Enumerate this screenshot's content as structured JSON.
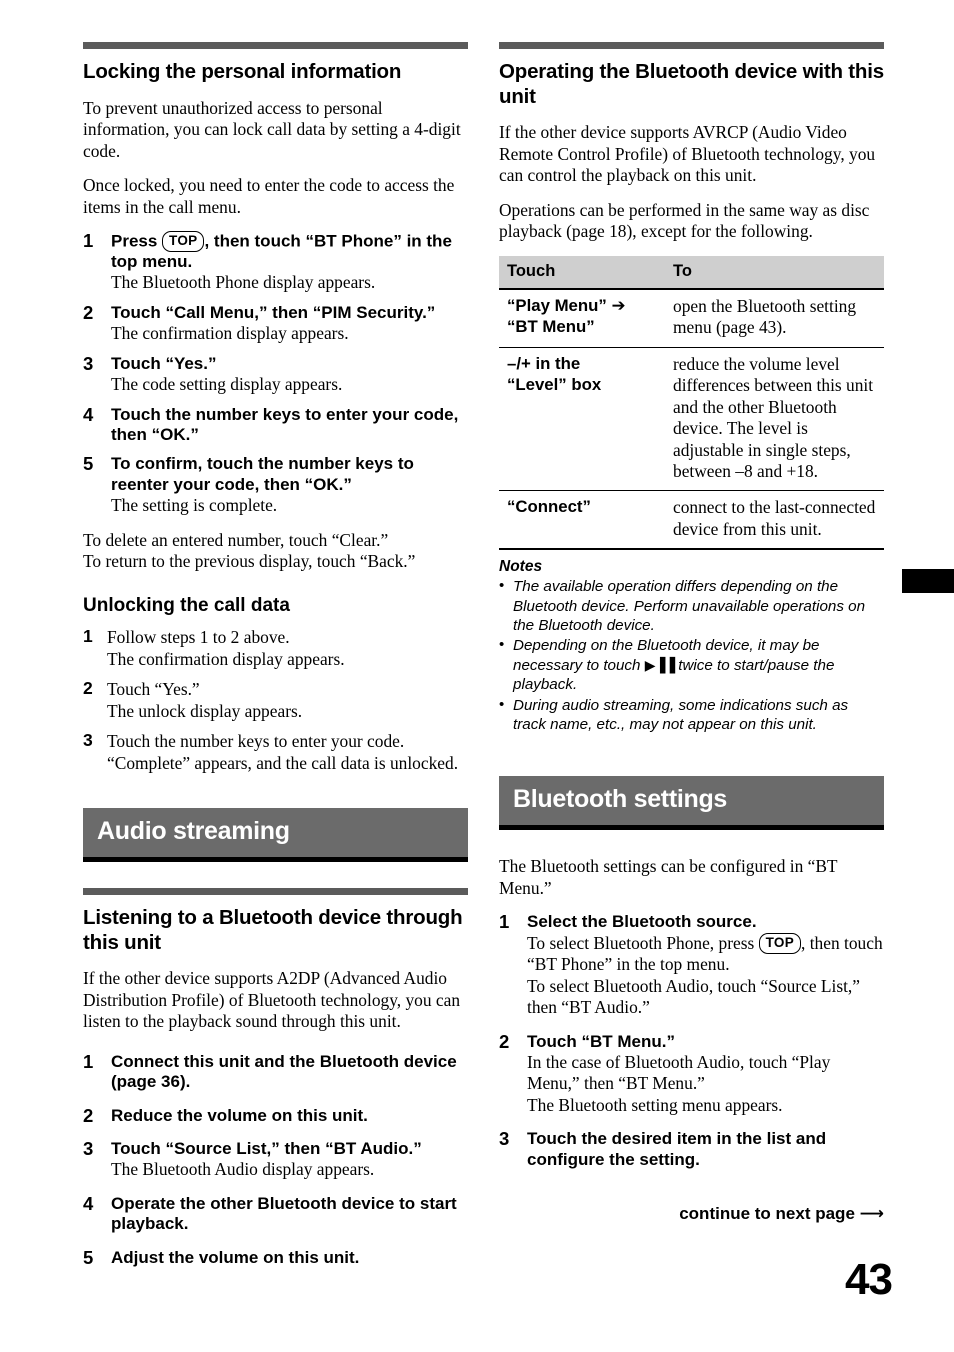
{
  "page": {
    "folio": "43",
    "edge_tab_color": "#000000",
    "banner_color": "#6b6b6b",
    "rule_color": "#5b5b5b",
    "table_header_color": "#cfcfcf"
  },
  "left_column": {
    "heading": "Locking the personal information",
    "intro_1": "To prevent unauthorized access to personal information, you can lock call data by setting a 4-digit code.",
    "intro_2": "Once locked, you need to enter the code to access the items in the call menu.",
    "steps": [
      {
        "num": "1",
        "lead_before_key": "Press ",
        "key": "TOP",
        "lead_after_key": ", then touch “BT Phone” in the top menu.",
        "note": "The Bluetooth Phone display appears."
      },
      {
        "num": "2",
        "lead": "Touch “Call Menu,” then “PIM Security.”",
        "note": "The confirmation display appears."
      },
      {
        "num": "3",
        "lead": "Touch “Yes.”",
        "note": "The code setting display appears."
      },
      {
        "num": "4",
        "lead": "Touch the number keys to enter your code, then “OK.”",
        "note": ""
      },
      {
        "num": "5",
        "lead": "To confirm, touch the number keys to reenter your code, then “OK.”",
        "note": "The setting is complete."
      }
    ],
    "outro_1": "To delete an entered number, touch “Clear.”",
    "outro_2": "To return to the previous display, touch “Back.”",
    "unlock_heading": "Unlocking the call data",
    "unlock_steps": [
      {
        "num": "1",
        "lead": "Follow steps 1 to 2 above.",
        "note": "The confirmation display appears."
      },
      {
        "num": "2",
        "lead": "Touch “Yes.”",
        "note": "The unlock display appears."
      },
      {
        "num": "3",
        "lead": "Touch the number keys to enter your code.",
        "note": "“Complete” appears, and the call data is unlocked."
      }
    ],
    "banner": "Audio streaming",
    "listening_heading": "Listening to a Bluetooth device through this unit",
    "listening_intro": "If the other device supports A2DP (Advanced Audio Distribution Profile) of Bluetooth technology, you can listen to the playback sound through this unit.",
    "listening_steps": [
      {
        "num": "1",
        "lead": "Connect this unit and the Bluetooth device (page 36).",
        "note": ""
      },
      {
        "num": "2",
        "lead": "Reduce the volume on this unit.",
        "note": ""
      },
      {
        "num": "3",
        "lead": "Touch “Source List,” then “BT Audio.”",
        "note": "The Bluetooth Audio display appears."
      },
      {
        "num": "4",
        "lead": "Operate the other Bluetooth device to start playback.",
        "note": ""
      },
      {
        "num": "5",
        "lead": "Adjust the volume on this unit.",
        "note": ""
      }
    ]
  },
  "right_column": {
    "heading": "Operating the Bluetooth device with this unit",
    "intro_1": "If the other device supports AVRCP (Audio Video Remote Control Profile) of Bluetooth technology, you can control the playback on this unit.",
    "intro_2": "Operations can be performed in the same way as disc playback (page 18), except for the following.",
    "table": {
      "headers": [
        "Touch",
        "To"
      ],
      "rows": [
        {
          "touch_line1": "“Play Menu” ➔",
          "touch_line2": "“BT Menu”",
          "to": "open the Bluetooth setting menu (page 43)."
        },
        {
          "touch_line1": "–/+ in the",
          "touch_line2": "“Level” box",
          "to": "reduce the volume level differences between this unit and the other Bluetooth device. The level is adjustable in single steps, between –8 and +18."
        },
        {
          "touch_line1": "“Connect”",
          "touch_line2": "",
          "to": "connect to the last-connected device from this unit."
        }
      ]
    },
    "notes_title": "Notes",
    "notes": [
      {
        "text_before": "The available operation differs depending on the Bluetooth device. Perform unavailable operations on the Bluetooth device.",
        "glyph": "",
        "text_after": ""
      },
      {
        "text_before": "Depending on the Bluetooth device, it may be necessary to touch ",
        "glyph": "▶▐▐",
        "text_after": " twice to start/pause the playback."
      },
      {
        "text_before": "During audio streaming, some indications such as track name, etc., may not appear on this unit.",
        "glyph": "",
        "text_after": ""
      }
    ],
    "banner": "Bluetooth settings",
    "settings_intro": "The Bluetooth settings can be configured in “BT Menu.”",
    "settings_steps": [
      {
        "num": "1",
        "lead": "Select the Bluetooth source.",
        "note_before_key": "To select Bluetooth Phone, press ",
        "key": "TOP",
        "note_after_key": ", then touch “BT Phone” in the top menu.",
        "note_line2": "To select Bluetooth Audio, touch “Source List,” then “BT Audio.”"
      },
      {
        "num": "2",
        "lead": "Touch “BT Menu.”",
        "note": "In the case of Bluetooth Audio, touch “Play Menu,” then “BT Menu.”",
        "note_line2": "The Bluetooth setting menu appears."
      },
      {
        "num": "3",
        "lead": "Touch the desired item in the list and configure the setting.",
        "note": ""
      }
    ],
    "continue_label": "continue to next page ⟶"
  }
}
